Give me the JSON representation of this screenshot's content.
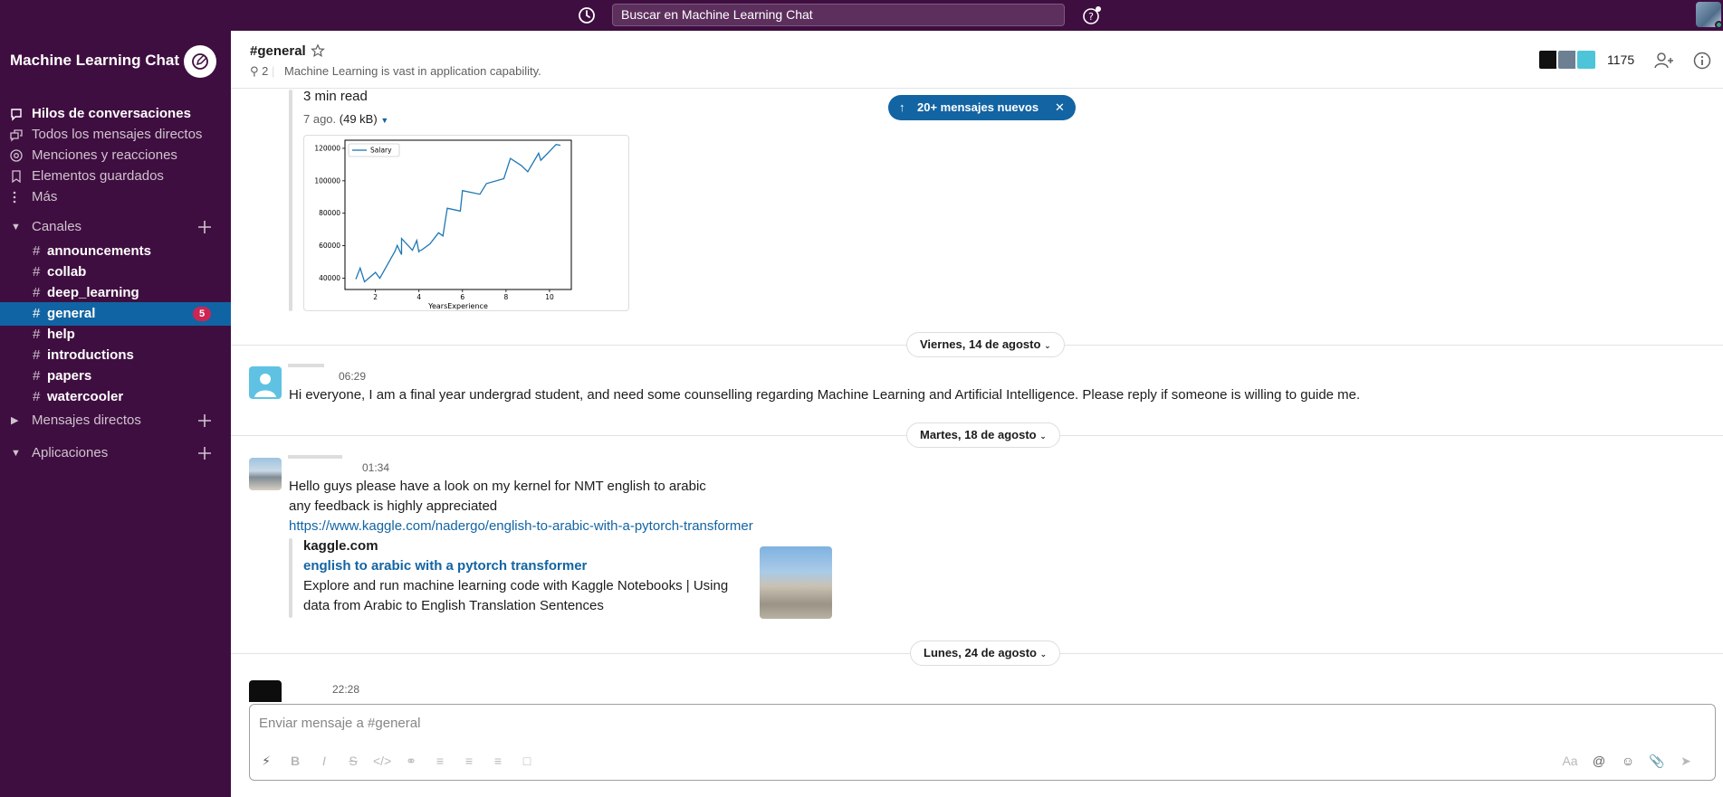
{
  "topbar": {
    "search_placeholder": "Buscar en Machine Learning Chat"
  },
  "sidebar": {
    "workspace_name": "Machine Learning Chat",
    "nav": [
      {
        "label": "Hilos de conversaciones",
        "icon": "threads-icon"
      },
      {
        "label": "Todos los mensajes directos",
        "icon": "dm-icon"
      },
      {
        "label": "Menciones y reacciones",
        "icon": "at-icon"
      },
      {
        "label": "Elementos guardados",
        "icon": "bookmark-icon"
      },
      {
        "label": "Más",
        "icon": "more-vertical-icon"
      }
    ],
    "channels_section": "Canales",
    "channels": [
      {
        "name": "announcements"
      },
      {
        "name": "collab"
      },
      {
        "name": "deep_learning"
      },
      {
        "name": "general",
        "active": true,
        "badge": "5"
      },
      {
        "name": "help"
      },
      {
        "name": "introductions"
      },
      {
        "name": "papers"
      },
      {
        "name": "watercooler"
      }
    ],
    "dm_section": "Mensajes directos",
    "apps_section": "Aplicaciones"
  },
  "header": {
    "channel": "#general",
    "pins": "2",
    "topic": "Machine Learning is vast in application capability.",
    "member_count": "1175"
  },
  "messages": {
    "new_messages_pill": "20+ mensajes nuevos",
    "read_time": "3 min read",
    "attachment_meta": "7 ago.",
    "attachment_size": "(49 kB)",
    "day1": "Viernes, 14 de agosto",
    "msg1_time": "06:29",
    "msg1_text": "Hi everyone, I am a final year undergrad student, and need some counselling regarding Machine Learning and Artificial Intelligence. Please reply if someone is willing to guide me.",
    "day2": "Martes, 18 de agosto",
    "msg2_time": "01:34",
    "msg2_line1": "Hello guys please have a look on my kernel for NMT english to arabic",
    "msg2_line2": "any feedback is highly appreciated",
    "msg2_link": "https://www.kaggle.com/nadergo/english-to-arabic-with-a-pytorch-transformer",
    "unfurl_site": "kaggle.com",
    "unfurl_title": "english to arabic with a pytorch transformer",
    "unfurl_desc1": "Explore and run machine learning code with Kaggle Notebooks | Using",
    "unfurl_desc2": "data from Arabic to English Translation Sentences",
    "day3": "Lunes, 24 de agosto",
    "msg3_time": "22:28"
  },
  "composer": {
    "placeholder": "Enviar mensaje a #general",
    "format_hint": "Aa"
  },
  "chart_data": {
    "type": "line",
    "x": [
      1.1,
      1.3,
      1.5,
      2.0,
      2.2,
      2.9,
      3.0,
      3.2,
      3.2,
      3.7,
      3.9,
      4.0,
      4.0,
      4.1,
      4.5,
      4.9,
      5.1,
      5.3,
      5.9,
      6.0,
      6.8,
      7.1,
      7.9,
      8.2,
      8.7,
      9.0,
      9.5,
      9.6,
      10.3,
      10.5
    ],
    "y": [
      39343,
      46205,
      37731,
      43525,
      39891,
      56642,
      60150,
      54445,
      64445,
      57189,
      63218,
      55794,
      56957,
      57081,
      61111,
      67938,
      66029,
      83088,
      81363,
      93940,
      91738,
      98273,
      101302,
      113812,
      109431,
      105582,
      116969,
      112635,
      122391,
      121872
    ],
    "legend": [
      "Salary"
    ],
    "xlabel": "YearsExperience",
    "xticks": [
      "2",
      "4",
      "6",
      "8",
      "10"
    ],
    "yticks": [
      "40000",
      "60000",
      "80000",
      "100000",
      "120000"
    ],
    "xlim": [
      0.6,
      11.0
    ],
    "ylim": [
      33000,
      125000
    ],
    "legend_position": "upper-left",
    "line_color": "#1f77b4"
  }
}
